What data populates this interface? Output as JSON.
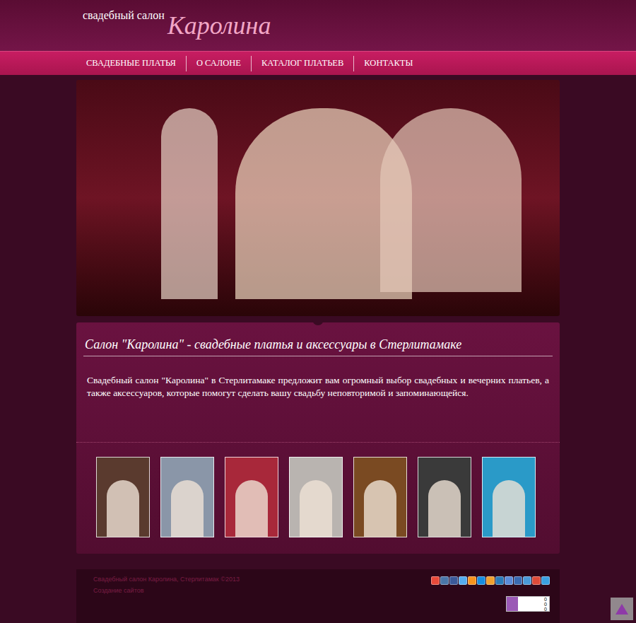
{
  "logo": {
    "prefix": "свадебный салон",
    "name": "Каролина"
  },
  "nav": [
    "СВАДЕБНЫЕ ПЛАТЬЯ",
    "О САЛОНЕ",
    "КАТАЛОГ ПЛАТЬЕВ",
    "КОНТАКТЫ"
  ],
  "intro": {
    "heading": "Салон \"Каролина\" - свадебные платья и аксессуары в Стерлитамаке",
    "text": "Свадебный салон \"Каролина\" в Стерлитамаке предложит вам огромный выбор свадебных и вечерних платьев, а также аксессуаров, которые помогут сделать вашу свадьбу неповторимой и запоминающейся."
  },
  "thumbnails": [
    {
      "color": "#5a3a2e"
    },
    {
      "color": "#8a96a8"
    },
    {
      "color": "#a8283a"
    },
    {
      "color": "#b9b4b0"
    },
    {
      "color": "#7a4a22"
    },
    {
      "color": "#3a3a3a"
    },
    {
      "color": "#2a9ac8"
    }
  ],
  "footer": {
    "copyright": "Свадебный салон Каролина, Стерлитамак ©2013",
    "link": "Создание сайтов"
  },
  "share": [
    {
      "color": "#e84a3a"
    },
    {
      "color": "#4a76a8"
    },
    {
      "color": "#3b5998"
    },
    {
      "color": "#55acee"
    },
    {
      "color": "#f7931e"
    },
    {
      "color": "#168de2"
    },
    {
      "color": "#f0a030"
    },
    {
      "color": "#2a7ab8"
    },
    {
      "color": "#5a8ad8"
    },
    {
      "color": "#3a6ab0"
    },
    {
      "color": "#4a9ad8"
    },
    {
      "color": "#dd4b39"
    },
    {
      "color": "#3aa0e0"
    }
  ],
  "counter": {
    "digits": [
      "0",
      "0",
      "0"
    ]
  }
}
